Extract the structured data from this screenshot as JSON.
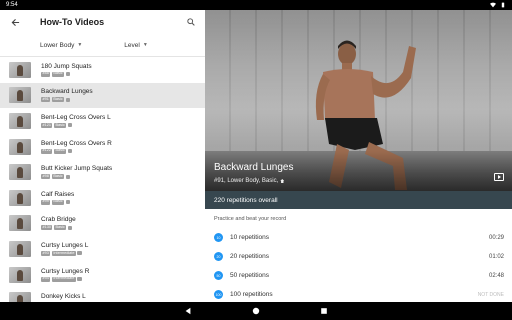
{
  "status_bar": {
    "time": "9:54",
    "icons": [
      "wifi-icon",
      "battery-icon"
    ]
  },
  "header": {
    "title": "How-To Videos",
    "back_icon": "arrow-back-icon",
    "search_icon": "search-icon"
  },
  "filters": [
    {
      "label": "Lower Body"
    },
    {
      "label": "Level"
    }
  ],
  "exercises": [
    {
      "name": "180 Jump Squats",
      "tags": [
        "#88",
        "Basic"
      ],
      "selected": false
    },
    {
      "name": "Backward Lunges",
      "tags": [
        "#91",
        "Basic"
      ],
      "selected": true
    },
    {
      "name": "Bent-Leg Cross Overs L",
      "tags": [
        "#121",
        "Basic"
      ],
      "selected": false
    },
    {
      "name": "Bent-Leg Cross Overs R",
      "tags": [
        "#122",
        "Basic"
      ],
      "selected": false
    },
    {
      "name": "Butt Kicker Jump Squats",
      "tags": [
        "#98",
        "Basic"
      ],
      "selected": false
    },
    {
      "name": "Calf Raises",
      "tags": [
        "#99",
        "Basic"
      ],
      "selected": false
    },
    {
      "name": "Crab Bridge",
      "tags": [
        "#130",
        "Basic"
      ],
      "selected": false
    },
    {
      "name": "Curtsy Lunges L",
      "tags": [
        "#93",
        "Intermediate"
      ],
      "selected": false
    },
    {
      "name": "Curtsy Lunges R",
      "tags": [
        "#94",
        "Intermediate"
      ],
      "selected": false
    },
    {
      "name": "Donkey Kicks L",
      "tags": [
        "#95",
        "Basic"
      ],
      "selected": false
    }
  ],
  "detail": {
    "title": "Backward Lunges",
    "subtitle": "#91, Lower Body, Basic,",
    "total": "220 repetitions overall",
    "practice_label": "Practice and beat your record",
    "records": [
      {
        "badge": "10",
        "label": "10 repetitions",
        "duration": "00:29",
        "done": true
      },
      {
        "badge": "20",
        "label": "20 repetitions",
        "duration": "01:02",
        "done": true
      },
      {
        "badge": "50",
        "label": "50 repetitions",
        "duration": "02:48",
        "done": true
      },
      {
        "badge": "100",
        "label": "100 repetitions",
        "duration": "NOT DONE",
        "done": false
      }
    ]
  },
  "nav": [
    "back-nav-icon",
    "home-nav-icon",
    "recents-nav-icon"
  ],
  "colors": {
    "accent": "#2196f3",
    "total_bar": "#37474f",
    "selected_row": "#e6e6e6"
  }
}
